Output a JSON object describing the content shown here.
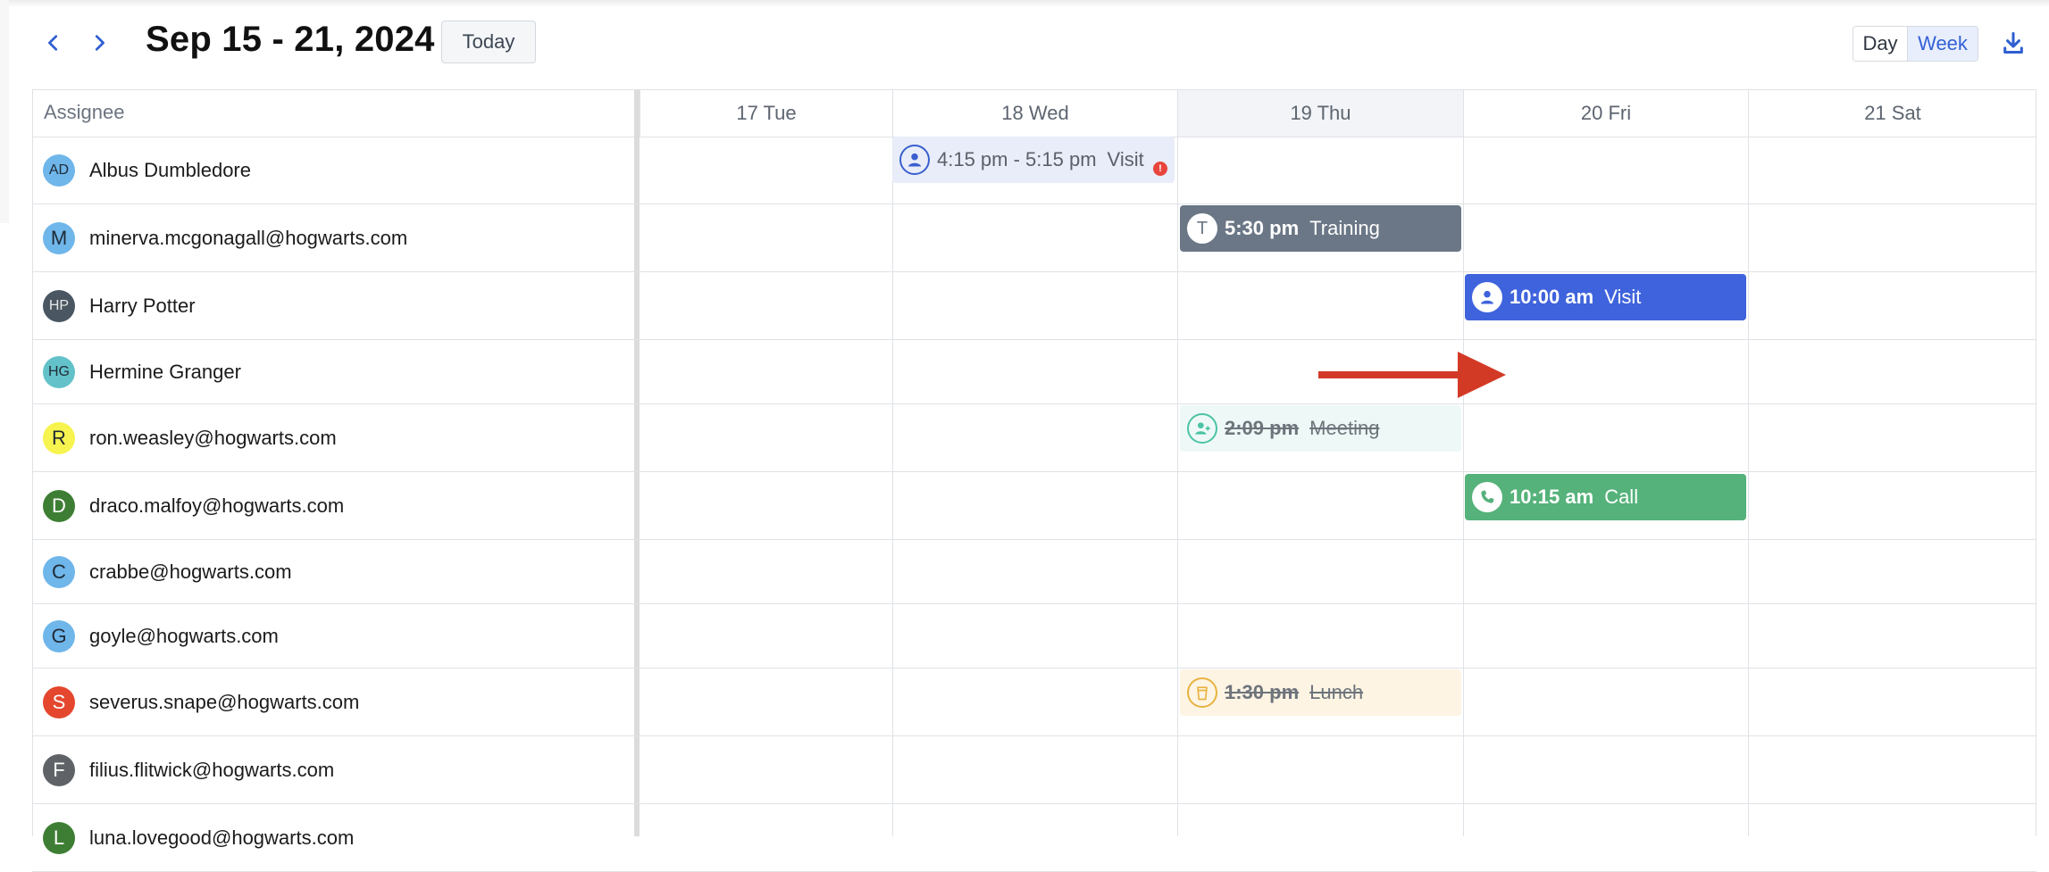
{
  "toolbar": {
    "prev_icon": "chevron-left-icon",
    "next_icon": "chevron-right-icon",
    "range_title": "Sep 15 - 21, 2024",
    "today_label": "Today",
    "view_options": [
      "Day",
      "Week"
    ],
    "selected_view": "Week",
    "download_icon": "download-icon"
  },
  "grid": {
    "assignee_header": "Assignee",
    "days": [
      {
        "label": "17 Tue",
        "today": false
      },
      {
        "label": "18 Wed",
        "today": false
      },
      {
        "label": "19 Thu",
        "today": true
      },
      {
        "label": "20 Fri",
        "today": false
      },
      {
        "label": "21 Sat",
        "today": false
      }
    ]
  },
  "assignees": [
    {
      "name": "Albus Dumbledore",
      "initials": "AD",
      "color": "#6fb6ea"
    },
    {
      "name": "minerva.mcgonagall@hogwarts.com",
      "initials": "M",
      "color": "#6fb6ea"
    },
    {
      "name": "Harry Potter",
      "initials": "HP",
      "color": "#4a5661"
    },
    {
      "name": "Hermine Granger",
      "initials": "HG",
      "color": "#63c2c9"
    },
    {
      "name": "ron.weasley@hogwarts.com",
      "initials": "R",
      "color": "#f7f34f"
    },
    {
      "name": "draco.malfoy@hogwarts.com",
      "initials": "D",
      "color": "#3e7e34"
    },
    {
      "name": "crabbe@hogwarts.com",
      "initials": "C",
      "color": "#6fb6ea"
    },
    {
      "name": "goyle@hogwarts.com",
      "initials": "G",
      "color": "#6fb6ea"
    },
    {
      "name": "severus.snape@hogwarts.com",
      "initials": "S",
      "color": "#e4472e"
    },
    {
      "name": "filius.flitwick@hogwarts.com",
      "initials": "F",
      "color": "#5f6368"
    },
    {
      "name": "luna.lovegood@hogwarts.com",
      "initials": "L",
      "color": "#3e7e34"
    }
  ],
  "events": [
    {
      "id": "visit-wed",
      "assignee": "Albus Dumbledore",
      "day": "18 Wed",
      "time": "4:15 pm - 5:15 pm",
      "title": "Visit",
      "icon": "person-icon",
      "status": "error",
      "color": "#e8edf9"
    },
    {
      "id": "training-thu",
      "assignee": "minerva.mcgonagall@hogwarts.com",
      "day": "19 Thu",
      "time": "5:30 pm",
      "title": "Training",
      "icon": "letter-t-icon",
      "icon_letter": "T",
      "color": "#6b7786"
    },
    {
      "id": "visit-fri",
      "assignee": "Harry Potter",
      "day": "20 Fri",
      "time": "10:00 am",
      "title": "Visit",
      "icon": "person-icon",
      "color": "#3f63dc"
    },
    {
      "id": "meeting-thu",
      "assignee": "ron.weasley@hogwarts.com",
      "day": "19 Thu",
      "time": "2:09 pm",
      "title": "Meeting",
      "icon": "person-add-icon",
      "status": "cancelled",
      "color": "#eef9f7"
    },
    {
      "id": "call-fri",
      "assignee": "draco.malfoy@hogwarts.com",
      "day": "20 Fri",
      "time": "10:15 am",
      "title": "Call",
      "icon": "phone-icon",
      "color": "#55b27a"
    },
    {
      "id": "lunch-thu",
      "assignee": "severus.snape@hogwarts.com",
      "day": "19 Thu",
      "time": "1:30 pm",
      "title": "Lunch",
      "icon": "cup-icon",
      "status": "cancelled",
      "color": "#fdf4e4"
    }
  ],
  "annotation": {
    "icon": "red-arrow-icon",
    "color": "#d33a26"
  }
}
